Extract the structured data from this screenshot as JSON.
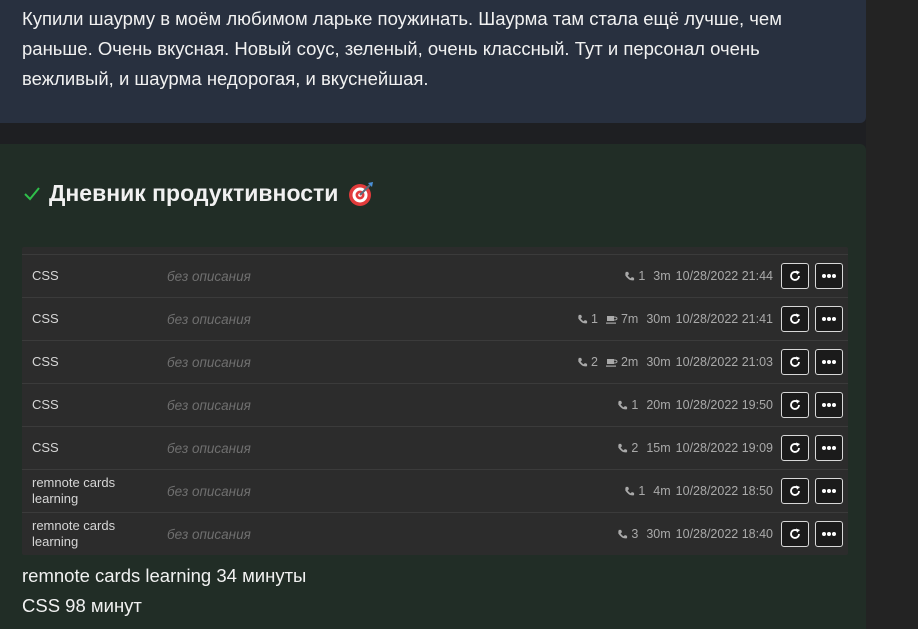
{
  "review": {
    "text": "Купили шаурму в моём любимом ларьке поужинать. Шаурма там стала ещё лучше, чем раньше. Очень вкусная. Новый соус, зеленый, очень классный. Тут и персонал очень вежливый, и шаурма недорогая, и вкуснейшая."
  },
  "diary": {
    "title": "Дневник продуктивности",
    "check_icon": "check-icon",
    "title_icon": "target-icon",
    "rows": [
      {
        "name": "CSS",
        "description": "без описания",
        "calls": "1",
        "breaks": "",
        "duration": "3m",
        "datetime": "10/28/2022 21:44"
      },
      {
        "name": "CSS",
        "description": "без описания",
        "calls": "1",
        "breaks": "7m",
        "duration": "30m",
        "datetime": "10/28/2022 21:41"
      },
      {
        "name": "CSS",
        "description": "без описания",
        "calls": "2",
        "breaks": "2m",
        "duration": "30m",
        "datetime": "10/28/2022 21:03"
      },
      {
        "name": "CSS",
        "description": "без описания",
        "calls": "1",
        "breaks": "",
        "duration": "20m",
        "datetime": "10/28/2022 19:50"
      },
      {
        "name": "CSS",
        "description": "без описания",
        "calls": "2",
        "breaks": "",
        "duration": "15m",
        "datetime": "10/28/2022 19:09"
      },
      {
        "name": "remnote cards learning",
        "description": "без описания",
        "calls": "1",
        "breaks": "",
        "duration": "4m",
        "datetime": "10/28/2022 18:50"
      },
      {
        "name": "remnote cards learning",
        "description": "без описания",
        "calls": "3",
        "breaks": "",
        "duration": "30m",
        "datetime": "10/28/2022 18:40"
      }
    ],
    "summary": [
      "remnote cards learning 34 минуты",
      "CSS 98 минут"
    ]
  },
  "colors": {
    "review_bg": "#28303f",
    "diary_bg": "#212d26",
    "check": "#2fbf4a",
    "target": "#e23b3b"
  }
}
